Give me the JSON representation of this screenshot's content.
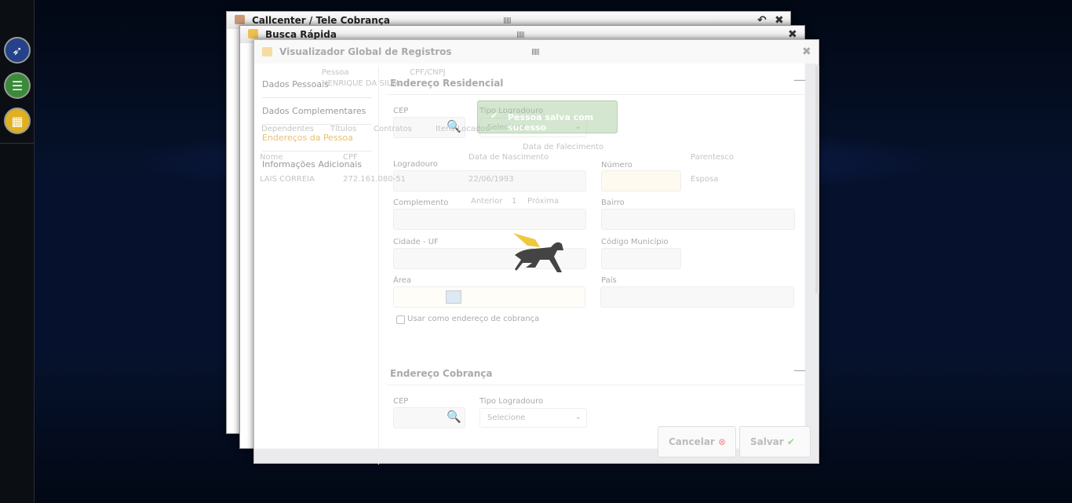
{
  "sidebar": {
    "items": [
      {
        "icon": "pegasus-logo-icon",
        "color": "#24418a"
      },
      {
        "icon": "list-icon",
        "color": "#3a8a3a"
      },
      {
        "icon": "grid-icon",
        "color": "#e0b020"
      }
    ]
  },
  "windows": {
    "callcenter": {
      "title": "Callcenter / Tele Cobrança"
    },
    "busca": {
      "title": "Busca Rápida",
      "person": {
        "label": "Pessoa",
        "value": "HENRIQUE DA SILVA",
        "cpf_label": "CPF/CNPJ"
      },
      "tabs": [
        "Dependentes",
        "Títulos",
        "Contratos",
        "Itens Locados"
      ],
      "table": {
        "headers": [
          "Nome",
          "CPF",
          "Data de Nascimento",
          "Data de Falecimento",
          "Parentesco"
        ],
        "rows": [
          [
            "LAIS CORREIA",
            "272.161.080-51",
            "22/06/1993",
            "",
            "Esposa"
          ]
        ]
      },
      "pagination": {
        "prev": "Anterior",
        "page": "1",
        "next": "Próxima"
      }
    },
    "visualizador": {
      "title": "Visualizador Global de Registros",
      "nav": [
        {
          "label": "Dados Pessoais"
        },
        {
          "label": "Dados Complementares"
        },
        {
          "label": "Endereços da Pessoa",
          "active": true
        },
        {
          "label": "Informações Adicionais"
        }
      ],
      "residencial": {
        "title": "Endereço Residencial",
        "cep": "CEP",
        "tipo_logradouro": "Tipo Logradouro",
        "tipo_value": "Selecione",
        "logradouro": "Logradouro",
        "numero": "Número",
        "complemento": "Complemento",
        "bairro": "Bairro",
        "cidade": "Cidade - UF",
        "codigo_municipio": "Código Município",
        "area": "Área",
        "pais": "País",
        "usar_cobranca": "Usar como endereço de cobrança"
      },
      "cobranca": {
        "title": "Endereço Cobrança",
        "cep": "CEP",
        "tipo_logradouro": "Tipo Logradouro",
        "tipo_value": "Selecione"
      },
      "buttons": {
        "cancel": "Cancelar",
        "save": "Salvar"
      }
    }
  },
  "toast": {
    "message": "Pessoa salva com sucesso",
    "color": "#8fc080"
  },
  "loading": {
    "icon": "pegasus-loading-icon"
  }
}
